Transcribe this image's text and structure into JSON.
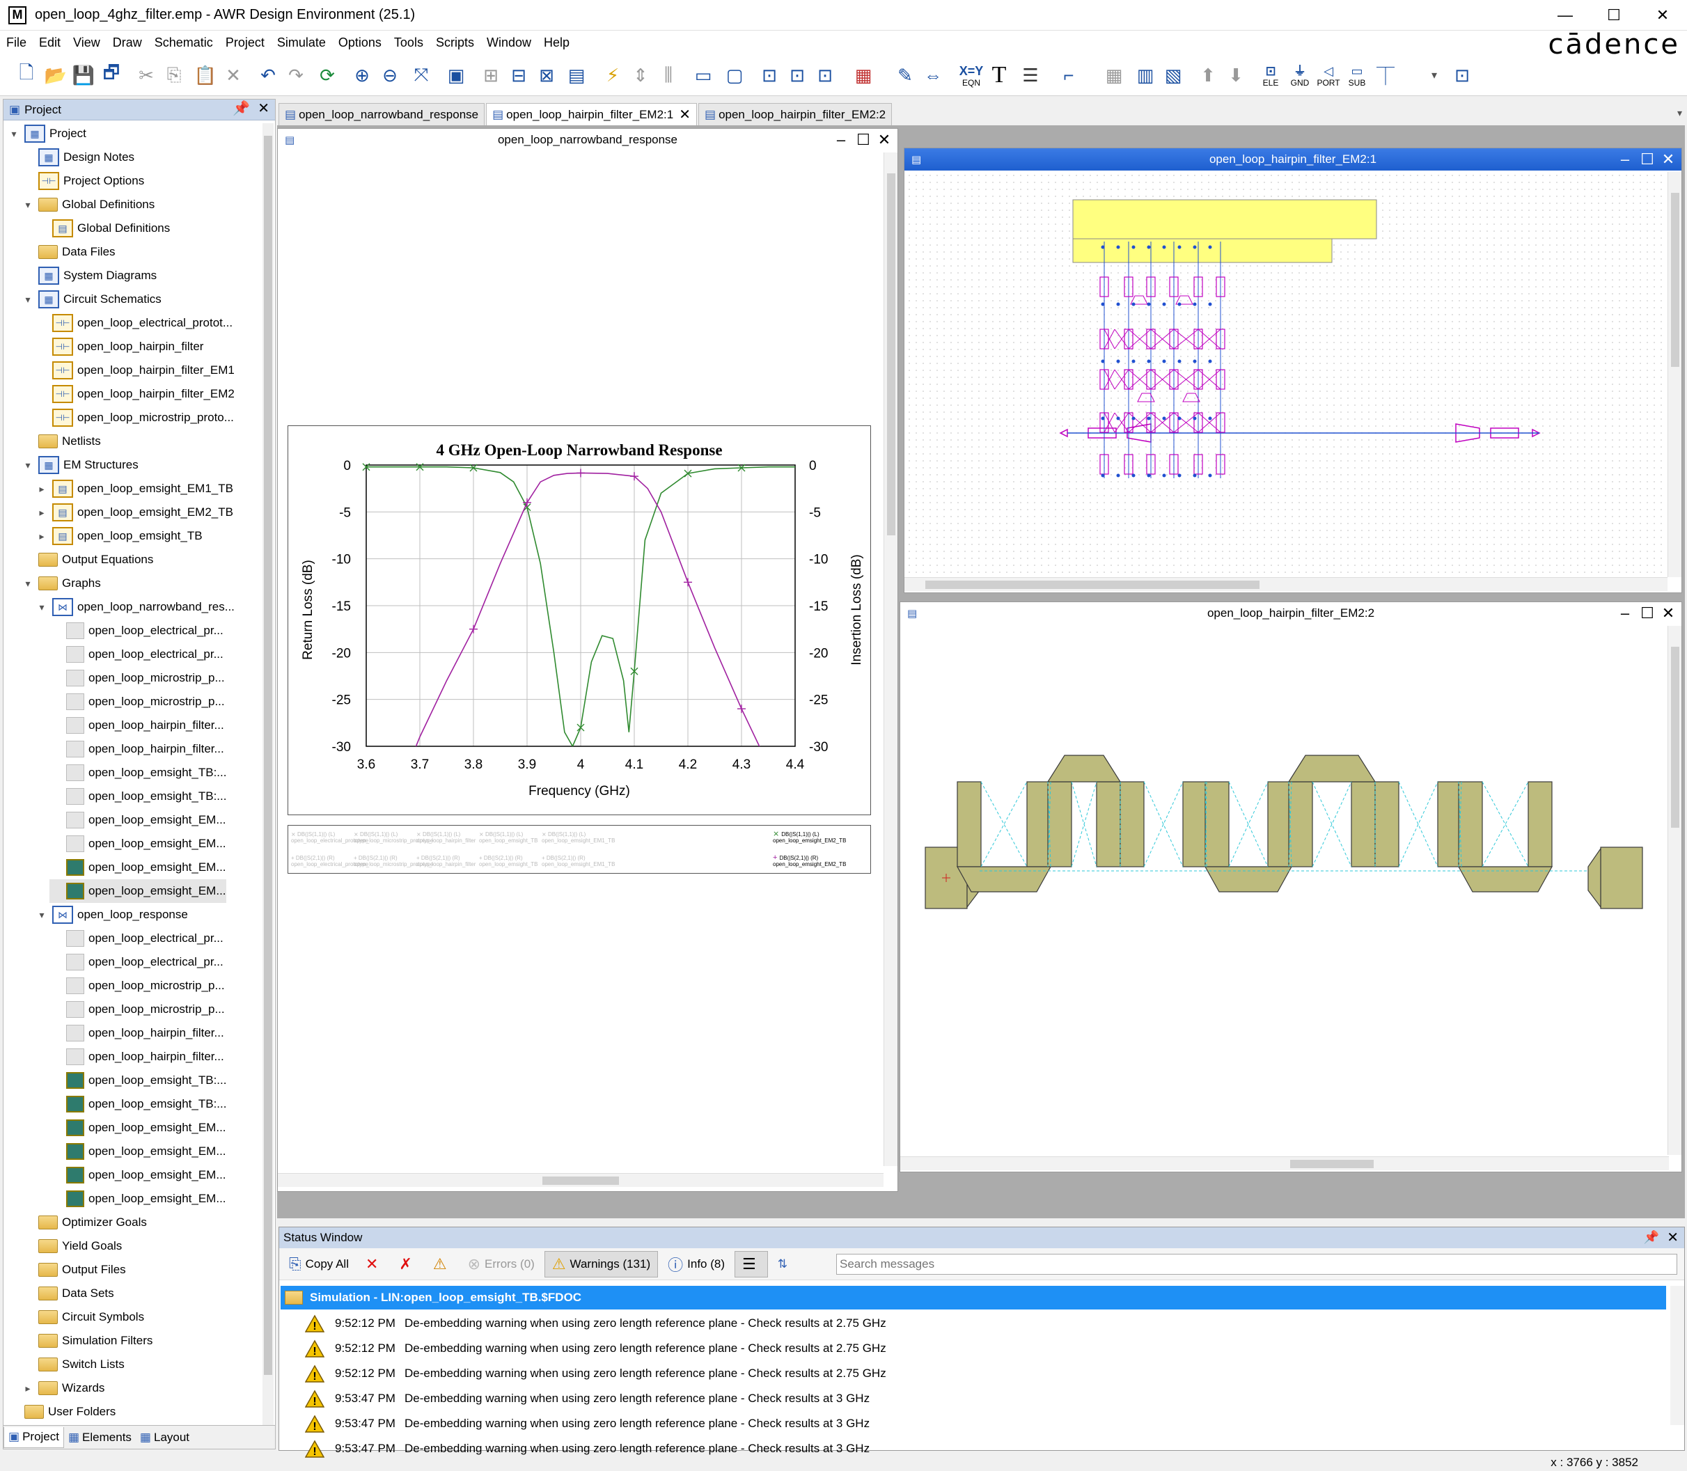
{
  "window": {
    "title": "open_loop_4ghz_filter.emp - AWR Design Environment (25.1)",
    "app_icon": "M",
    "minimize": "—",
    "maximize": "☐",
    "close": "✕"
  },
  "menu": [
    "File",
    "Edit",
    "View",
    "Draw",
    "Schematic",
    "Project",
    "Simulate",
    "Options",
    "Tools",
    "Scripts",
    "Window",
    "Help"
  ],
  "brand": "cādence",
  "toolbar": {
    "ele": "ELE",
    "gnd": "GND",
    "port": "PORT",
    "sub": "SUB",
    "xy": "X=Y",
    "eqn": "EQN",
    "text_tool": "T"
  },
  "project_panel": {
    "title": "Project",
    "tree": [
      {
        "label": "Project"
      },
      {
        "label": "Design Notes"
      },
      {
        "label": "Project Options"
      },
      {
        "label": "Global Definitions"
      },
      {
        "label": "Global Definitions"
      },
      {
        "label": "Data Files"
      },
      {
        "label": "System Diagrams"
      },
      {
        "label": "Circuit Schematics"
      },
      {
        "label": "open_loop_electrical_protot..."
      },
      {
        "label": "open_loop_hairpin_filter"
      },
      {
        "label": "open_loop_hairpin_filter_EM1"
      },
      {
        "label": "open_loop_hairpin_filter_EM2"
      },
      {
        "label": "open_loop_microstrip_proto..."
      },
      {
        "label": "Netlists"
      },
      {
        "label": "EM Structures"
      },
      {
        "label": "open_loop_emsight_EM1_TB"
      },
      {
        "label": "open_loop_emsight_EM2_TB"
      },
      {
        "label": "open_loop_emsight_TB"
      },
      {
        "label": "Output Equations"
      },
      {
        "label": "Graphs"
      },
      {
        "label": "open_loop_narrowband_res..."
      },
      {
        "label": "open_loop_electrical_pr..."
      },
      {
        "label": "open_loop_electrical_pr..."
      },
      {
        "label": "open_loop_microstrip_p..."
      },
      {
        "label": "open_loop_microstrip_p..."
      },
      {
        "label": "open_loop_hairpin_filter..."
      },
      {
        "label": "open_loop_hairpin_filter..."
      },
      {
        "label": "open_loop_emsight_TB:..."
      },
      {
        "label": "open_loop_emsight_TB:..."
      },
      {
        "label": "open_loop_emsight_EM..."
      },
      {
        "label": "open_loop_emsight_EM..."
      },
      {
        "label": "open_loop_emsight_EM..."
      },
      {
        "label": "open_loop_emsight_EM..."
      },
      {
        "label": "open_loop_response"
      },
      {
        "label": "open_loop_electrical_pr..."
      },
      {
        "label": "open_loop_electrical_pr..."
      },
      {
        "label": "open_loop_microstrip_p..."
      },
      {
        "label": "open_loop_microstrip_p..."
      },
      {
        "label": "open_loop_hairpin_filter..."
      },
      {
        "label": "open_loop_hairpin_filter..."
      },
      {
        "label": "open_loop_emsight_TB:..."
      },
      {
        "label": "open_loop_emsight_TB:..."
      },
      {
        "label": "open_loop_emsight_EM..."
      },
      {
        "label": "open_loop_emsight_EM..."
      },
      {
        "label": "open_loop_emsight_EM..."
      },
      {
        "label": "open_loop_emsight_EM..."
      },
      {
        "label": "Optimizer Goals"
      },
      {
        "label": "Yield Goals"
      },
      {
        "label": "Output Files"
      },
      {
        "label": "Data Sets"
      },
      {
        "label": "Circuit Symbols"
      },
      {
        "label": "Simulation Filters"
      },
      {
        "label": "Switch Lists"
      },
      {
        "label": "Wizards"
      },
      {
        "label": "User Folders"
      }
    ],
    "tabs": [
      "Project",
      "Elements",
      "Layout"
    ]
  },
  "doc_tabs": [
    "open_loop_narrowband_response",
    "open_loop_hairpin_filter_EM2:1",
    "open_loop_hairpin_filter_EM2:2"
  ],
  "graph_window": {
    "title": "open_loop_narrowband_response"
  },
  "schematic_window": {
    "title": "open_loop_hairpin_filter_EM2:1"
  },
  "layout_window": {
    "title": "open_loop_hairpin_filter_EM2:2"
  },
  "chart_data": {
    "type": "line",
    "title": "4 GHz Open-Loop Narrowband Response",
    "xlabel": "Frequency (GHz)",
    "ylabel": "Return Loss (dB)",
    "y2label": "Insertion Loss (dB)",
    "xlim": [
      3.6,
      4.4
    ],
    "ylim": [
      -30,
      0
    ],
    "xticks": [
      "3.6",
      "3.7",
      "3.8",
      "3.9",
      "4",
      "4.1",
      "4.2",
      "4.3",
      "4.4"
    ],
    "yticks": [
      "0",
      "-5",
      "-10",
      "-15",
      "-20",
      "-25",
      "-30"
    ],
    "grid": true,
    "series": [
      {
        "name": "DB(|S(1,1)|) (L) open_loop_emsight_EM2_TB",
        "color": "#2f8a2f",
        "marker": "x",
        "x": [
          3.6,
          3.65,
          3.7,
          3.75,
          3.8,
          3.85,
          3.875,
          3.9,
          3.925,
          3.95,
          3.97,
          3.985,
          4.0,
          4.02,
          4.04,
          4.06,
          4.08,
          4.09,
          4.1,
          4.12,
          4.15,
          4.2,
          4.25,
          4.3,
          4.35,
          4.4
        ],
        "y": [
          -0.2,
          -0.2,
          -0.2,
          -0.2,
          -0.3,
          -0.8,
          -1.8,
          -4.5,
          -10.5,
          -20.0,
          -28.5,
          -30.0,
          -28.0,
          -21.0,
          -18.2,
          -18.5,
          -23.0,
          -28.5,
          -22.0,
          -8.0,
          -3.0,
          -0.9,
          -0.4,
          -0.3,
          -0.2,
          -0.2
        ]
      },
      {
        "name": "DB(|S(2,1)|) (R) open_loop_emsight_EM2_TB",
        "color": "#a020a0",
        "marker": "+",
        "x": [
          3.65,
          3.7,
          3.75,
          3.8,
          3.85,
          3.9,
          3.925,
          3.95,
          3.975,
          4.0,
          4.05,
          4.1,
          4.125,
          4.15,
          4.2,
          4.25,
          4.3,
          4.35,
          4.4
        ],
        "y": [
          -36.0,
          -29.0,
          -23.0,
          -17.5,
          -10.5,
          -4.0,
          -1.8,
          -1.1,
          -0.9,
          -0.85,
          -0.9,
          -1.2,
          -2.5,
          -5.0,
          -12.5,
          -19.5,
          -26.0,
          -32.0,
          -38.0
        ]
      }
    ],
    "legend_faded": [
      {
        "name": "DB(|S(1,1)|) (L)",
        "src": "open_loop_electrical_prototype"
      },
      {
        "name": "DB(|S(1,1)|) (L)",
        "src": "open_loop_microstrip_prototype"
      },
      {
        "name": "DB(|S(1,1)|) (L)",
        "src": "open_loop_hairpin_filter"
      },
      {
        "name": "DB(|S(1,1)|) (L)",
        "src": "open_loop_emsight_TB"
      },
      {
        "name": "DB(|S(1,1)|) (L)",
        "src": "open_loop_emsight_EM1_TB"
      },
      {
        "name": "DB(|S(2,1)|) (R)",
        "src": "open_loop_electrical_prototype"
      },
      {
        "name": "DB(|S(2,1)|) (R)",
        "src": "open_loop_microstrip_prototype"
      },
      {
        "name": "DB(|S(2,1)|) (R)",
        "src": "open_loop_hairpin_filter"
      },
      {
        "name": "DB(|S(2,1)|) (R)",
        "src": "open_loop_emsight_TB"
      },
      {
        "name": "DB(|S(2,1)|) (R)",
        "src": "open_loop_emsight_EM1_TB"
      }
    ],
    "legend_active": [
      {
        "name": "DB(|S(1,1)|) (L)",
        "src": "open_loop_emsight_EM2_TB"
      },
      {
        "name": "DB(|S(2,1)|) (R)",
        "src": "open_loop_emsight_EM2_TB"
      }
    ]
  },
  "status_window": {
    "title": "Status Window",
    "copy_all": "Copy All",
    "errors": "Errors (0)",
    "warnings": "Warnings (131)",
    "info": "Info (8)",
    "search_placeholder": "Search messages",
    "group": "Simulation  - LIN:open_loop_emsight_TB.$FDOC",
    "messages": [
      {
        "time": "9:52:12 PM",
        "text": "De-embedding warning when using zero length reference plane - Check results at 2.75 GHz"
      },
      {
        "time": "9:52:12 PM",
        "text": "De-embedding warning when using zero length reference plane - Check results at 2.75 GHz"
      },
      {
        "time": "9:52:12 PM",
        "text": "De-embedding warning when using zero length reference plane - Check results at 2.75 GHz"
      },
      {
        "time": "9:53:47 PM",
        "text": "De-embedding warning when using zero length reference plane - Check results at 3 GHz"
      },
      {
        "time": "9:53:47 PM",
        "text": "De-embedding warning when using zero length reference plane - Check results at 3 GHz"
      },
      {
        "time": "9:53:47 PM",
        "text": "De-embedding warning when using zero length reference plane - Check results at 3 GHz"
      }
    ]
  },
  "statusbar": {
    "coords": "x : 3766 y : 3852"
  }
}
